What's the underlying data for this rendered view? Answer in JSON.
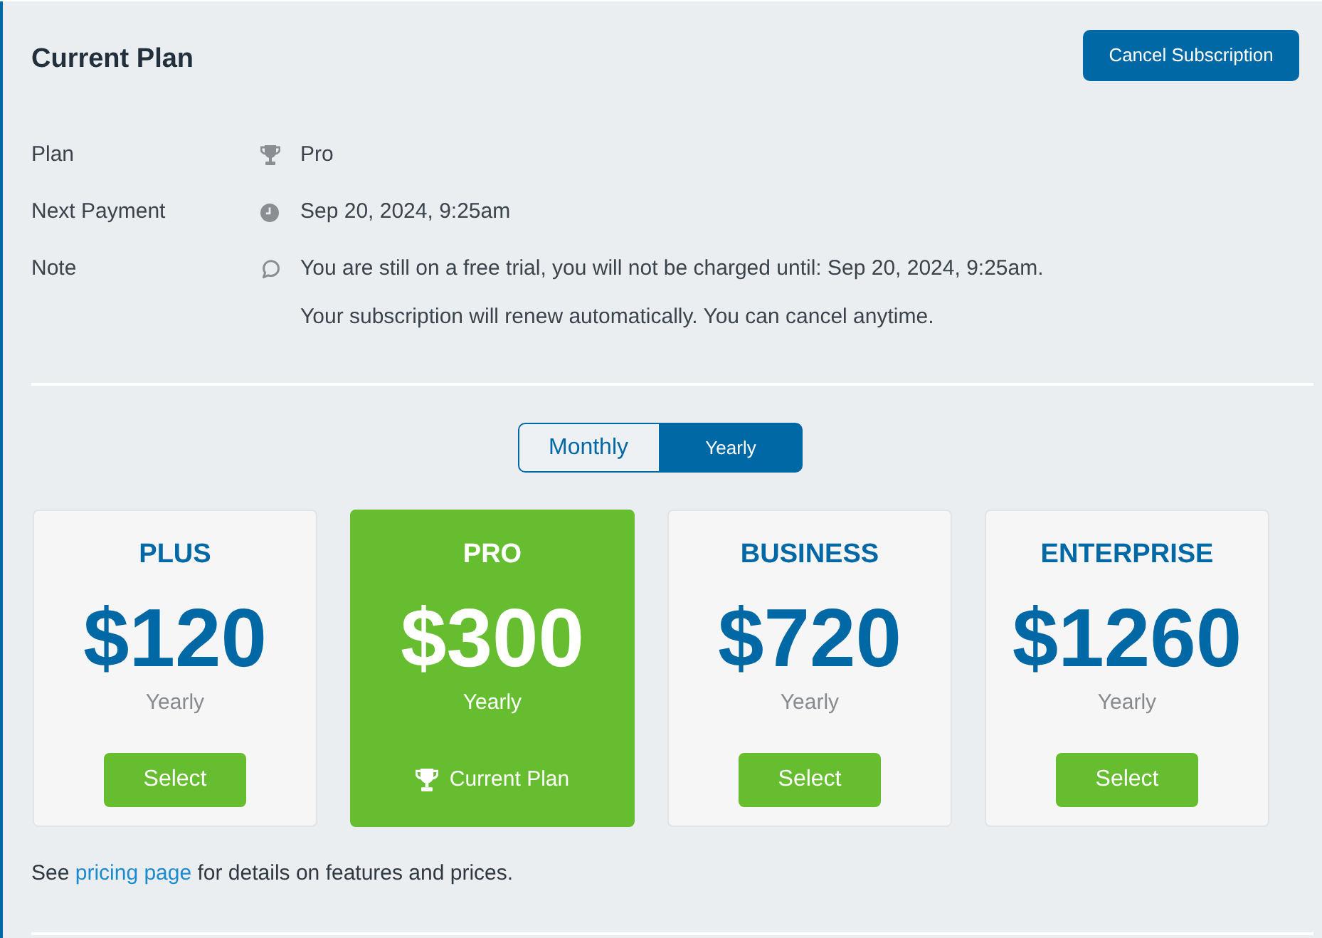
{
  "header": {
    "title": "Current Plan",
    "cancel_button": "Cancel Subscription"
  },
  "details": [
    {
      "label": "Plan",
      "lines": [
        "Pro"
      ]
    },
    {
      "label": "Next Payment",
      "lines": [
        "Sep 20, 2024, 9:25am"
      ]
    },
    {
      "label": "Note",
      "lines": [
        "You are still on a free trial, you will not be charged until: Sep 20, 2024, 9:25am.",
        "Your subscription will renew automatically. You can cancel anytime."
      ]
    }
  ],
  "billing_toggle": [
    {
      "label": "Monthly",
      "selected": false
    },
    {
      "label": "Yearly",
      "selected": true
    }
  ],
  "plans": [
    {
      "name": "PLUS",
      "price": "$120",
      "period": "Yearly",
      "current": false,
      "action": "Select"
    },
    {
      "name": "PRO",
      "price": "$300",
      "period": "Yearly",
      "current": true,
      "action": "Current Plan"
    },
    {
      "name": "BUSINESS",
      "price": "$720",
      "period": "Yearly",
      "current": false,
      "action": "Select"
    },
    {
      "name": "ENTERPRISE",
      "price": "$1260",
      "period": "Yearly",
      "current": false,
      "action": "Select"
    }
  ],
  "footer": {
    "before": "See ",
    "link": "pricing page",
    "after": " for details on features and prices."
  }
}
